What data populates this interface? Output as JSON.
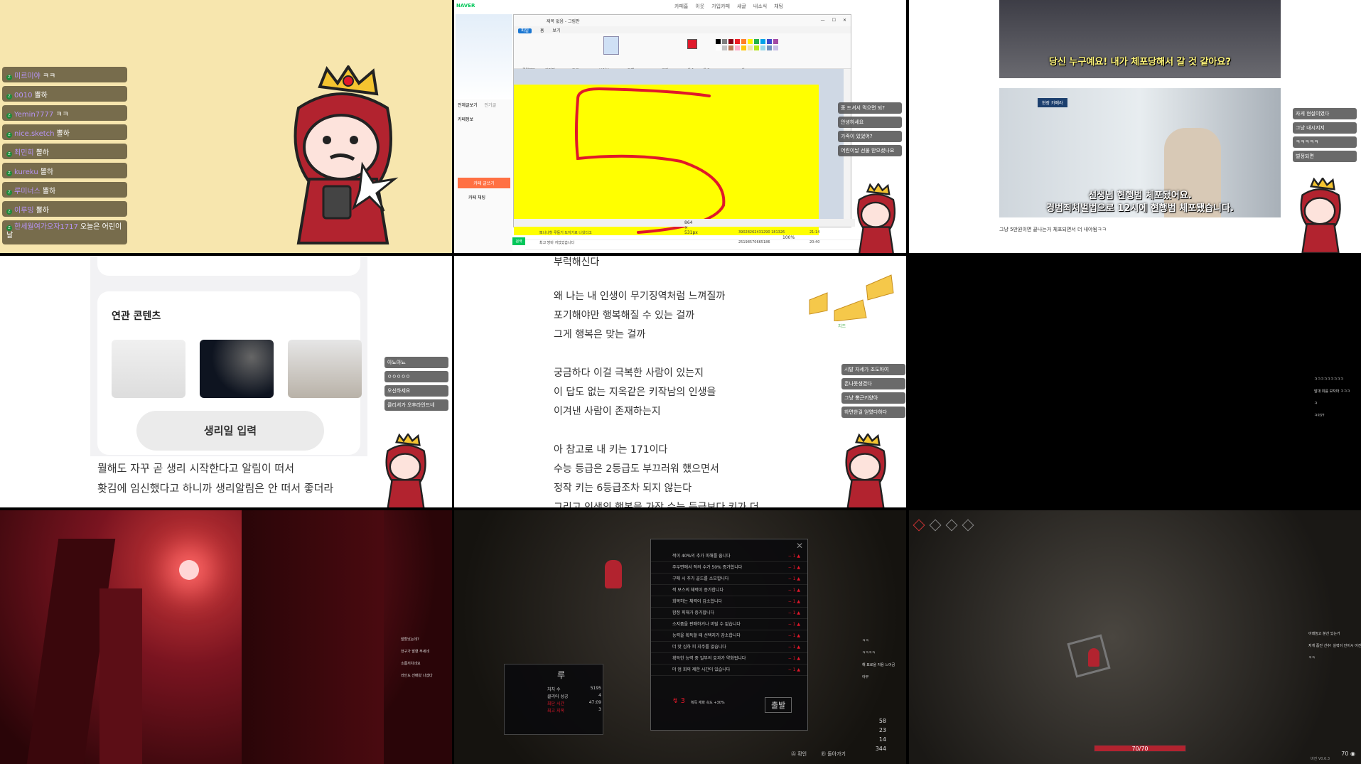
{
  "cells": {
    "c1": {
      "chat": [
        {
          "name": "미르미야",
          "text": "ㅋㅋ"
        },
        {
          "name": "0010",
          "text": "뽈하"
        },
        {
          "name": "Yemin7777",
          "text": "ㅋㅋ"
        },
        {
          "name": "nice.sketch",
          "text": "뽈하"
        },
        {
          "name": "최민희",
          "text": "뽈하"
        },
        {
          "name": "kureku",
          "text": "뽈하"
        },
        {
          "name": "루미너스",
          "text": "뽈하"
        },
        {
          "name": "이루밍",
          "text": "뽈하"
        },
        {
          "name": "한세월여가오자1717",
          "text": "오늘은 어린이날"
        }
      ]
    },
    "c2": {
      "naver_logo": "NAVER",
      "top_nav": [
        "카페홈",
        "이웃",
        "가입카페",
        "새글",
        "내소식",
        "채팅"
      ],
      "paint_title": "제목 없음 - 그림판",
      "paint_menu": [
        "파일",
        "홈",
        "보기"
      ],
      "ribbon_groups": [
        "클립보드",
        "이미지",
        "도구",
        "브러시",
        "도형",
        "크기",
        "색 1",
        "색 2",
        "색"
      ],
      "status_size": "864 × 531px",
      "zoom": "100%",
      "drawn_number": "5",
      "cafe_tabs": [
        "전체글보기",
        "인기글"
      ],
      "cafe_info_label": "카페정보",
      "cafe_write_button": "카페 글쓰기",
      "cafe_join": "카페 채팅",
      "search_button": "검색",
      "side_chat": [
        "종 드셔서 먹으면 되?",
        "안녕하세요",
        "가족이 있었어?",
        "어린이날 선물 받으셨나요"
      ],
      "list_rows": [
        {
          "title": "뽀나나핫 루돌기 도지기로 나왔다고",
          "id": "39028262431290 181326",
          "time": "21:14"
        },
        {
          "title": "최고 방바 지었었습니다",
          "id": "25198570665186",
          "time": "20:40"
        }
      ]
    },
    "c3": {
      "subtitle_1": "당신 누구예요! 내가 체포당해서 갈 것 같아요?",
      "subtitle_2a": "선생님 현행범 체포됐어요.",
      "subtitle_2b": "경범죄처벌법으로 12시에 현행범 체포됐습니다.",
      "caption": "그냥 5만원이면 끝나는거 체포되면서 더 내야됨ㅋㅋ",
      "sign": "현장 카메라",
      "side_chat": [
        "자게 현실이었다",
        "그냥 내시지지",
        "ㅋㅋㅋㅋㅋ",
        "벌정되면"
      ]
    },
    "c4": {
      "section_title": "연관 콘텐츠",
      "button_label": "생리일 입력",
      "body_line_1": "뭘해도 자꾸 곧 생리 시작한다고 알림이 떠서",
      "body_line_2": "홧김에 임신했다고 하니까 생리알림은 안 떠서 좋더라",
      "side_chat": [
        "아뇨아뇨",
        "ㅇㅇㅇㅇㅇ",
        "오신하세요",
        "클리셔가 오후라인드네"
      ]
    },
    "c5": {
      "lines": [
        "부럭해신다",
        "왜 나는 내 인생이 무기징역처럼 느껴질까",
        "포기해야만 행복해질 수 있는 걸까",
        "그게 행복은 맞는 걸까",
        "궁금하다 이걸 극복한 사람이 있는지",
        "이 답도 없는 지옥같은 키작남의 인생을",
        "이겨낸 사람이 존재하는지",
        "아 참고로 내 키는 171이다",
        "수능 등급은 2등급도 부끄러워 했으면서",
        "정작 키는 6등급조차 되지 않는다",
        "그리고 인생의 행복을 가장 수능 등급보다 키가 더"
      ],
      "cheese_label": "치즈",
      "side_chat": [
        "시발 자세가 조도하여",
        "존나못생겼다",
        "그냥 뽕근키양아",
        "하면한걸 얻였다하다"
      ]
    },
    "c6": {
      "side_chat": [
        "ㅋㅋㅋㅋㅋㅋㅋㅋㅋ",
        "말대 위를 보자마 ㅋㅋㅋ",
        "ㅋ",
        "ㅋ아??"
      ]
    },
    "c7": {
      "side_chat": [
        "발할났는데?",
        "전구가 발렸 부세네",
        "소름끼치네요",
        "라인도 선배왔 나겠다"
      ]
    },
    "c8": {
      "perks": [
        "적이 40%의 추가 피해를 줍니다",
        "주우면에서 적의 수가 50% 증가합니다",
        "구매 시 추가 골드를 소모합니다",
        "적 보스의 체력이 증가합니다",
        "회복하는 체력이 감소합니다",
        "함정 피해가 증가합니다",
        "소지품을 판매하거나 버릴 수 없습니다",
        "능력을 획득할 때 선택지가 감소합니다",
        "더 맛 심하 피 지주를 없습니다",
        "획득한 능력 중 일부의 효과가 약화됩니다",
        "더 업 회의 제한 시간이 있습니다"
      ],
      "character_name": "루",
      "stats": [
        {
          "label": "처치 수",
          "value": "5195"
        },
        {
          "label": "클리어 성공",
          "value": "4"
        },
        {
          "label": "최단 시간",
          "value": "47:09"
        },
        {
          "label": "최고 지옥",
          "value": "3"
        }
      ],
      "level_text": "3",
      "reward_text": "획득 재화 속도 +30%",
      "start_button": "출발",
      "confirm_hint": "확인",
      "back_hint": "돌아가기",
      "resources": [
        "58",
        "23",
        "14",
        "344"
      ],
      "side_chat": [
        "ㅋㅋ",
        "ㅋㅋㅋㅋ",
        "해 표로을 저용 느어금",
        "아무"
      ]
    },
    "c9": {
      "hp": "70/70",
      "coins": "70",
      "version": "버전 V0.6.3",
      "side_chat": [
        "아래높고 분산 있는거",
        "저게 좀진 선수! 실력이 안이시 어진 빛을 하고 없어 없다",
        "ㅋㅋ"
      ]
    }
  },
  "colors": {
    "c1_bg": "#f7e6ae",
    "paint_yellow": "#ffff00",
    "stroke_red": "#e0182a",
    "chat_green": "#1e8a3a",
    "red_room": "#7a1420"
  }
}
